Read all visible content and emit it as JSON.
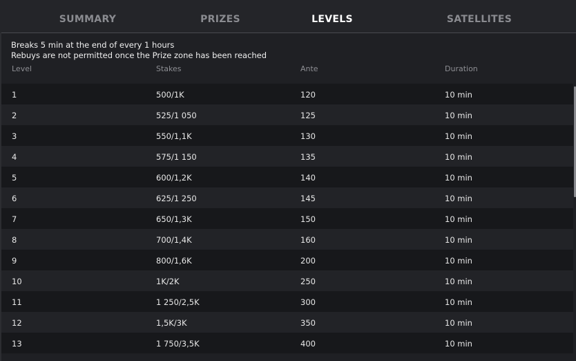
{
  "tabs": [
    {
      "label": "SUMMARY",
      "active": false
    },
    {
      "label": "PRIZES",
      "active": false
    },
    {
      "label": "LEVELS",
      "active": true
    },
    {
      "label": "SATELLITES",
      "active": false
    }
  ],
  "info": {
    "line1": "Breaks 5 min at the end of every 1 hours",
    "line2": "Rebuys are not permitted once the Prize zone has been reached"
  },
  "columns": {
    "level": "Level",
    "stakes": "Stakes",
    "ante": "Ante",
    "duration": "Duration"
  },
  "rows": [
    {
      "level": "1",
      "stakes": "500/1K",
      "ante": "120",
      "duration": "10 min"
    },
    {
      "level": "2",
      "stakes": "525/1 050",
      "ante": "125",
      "duration": "10 min"
    },
    {
      "level": "3",
      "stakes": "550/1,1K",
      "ante": "130",
      "duration": "10 min"
    },
    {
      "level": "4",
      "stakes": "575/1 150",
      "ante": "135",
      "duration": "10 min"
    },
    {
      "level": "5",
      "stakes": "600/1,2K",
      "ante": "140",
      "duration": "10 min"
    },
    {
      "level": "6",
      "stakes": "625/1 250",
      "ante": "145",
      "duration": "10 min"
    },
    {
      "level": "7",
      "stakes": "650/1,3K",
      "ante": "150",
      "duration": "10 min"
    },
    {
      "level": "8",
      "stakes": "700/1,4K",
      "ante": "160",
      "duration": "10 min"
    },
    {
      "level": "9",
      "stakes": "800/1,6K",
      "ante": "200",
      "duration": "10 min"
    },
    {
      "level": "10",
      "stakes": "1K/2K",
      "ante": "250",
      "duration": "10 min"
    },
    {
      "level": "11",
      "stakes": "1 250/2,5K",
      "ante": "300",
      "duration": "10 min"
    },
    {
      "level": "12",
      "stakes": "1,5K/3K",
      "ante": "350",
      "duration": "10 min"
    },
    {
      "level": "13",
      "stakes": "1 750/3,5K",
      "ante": "400",
      "duration": "10 min"
    }
  ],
  "colors": {
    "background": "#1f2024",
    "row_dark": "#17181b",
    "row_light": "#222327",
    "tab_active": "#ffffff",
    "tab_inactive": "#8a8b90"
  }
}
